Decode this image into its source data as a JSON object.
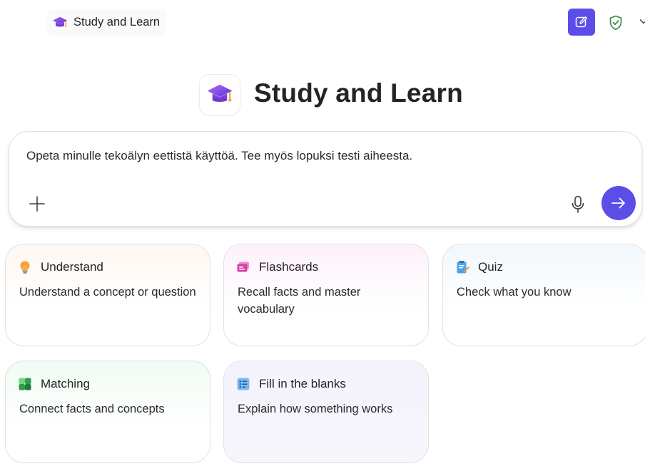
{
  "header": {
    "app_title": "Study and Learn",
    "new_chat_icon": "edit-square-icon",
    "shield_icon": "shield-check-icon"
  },
  "hero": {
    "title": "Study and Learn",
    "icon": "graduation-cap-icon"
  },
  "composer": {
    "text": "Opeta minulle tekoälyn eettistä käyttöä. Tee myös lopuksi testi aiheesta.",
    "add_icon": "plus-icon",
    "mic_icon": "microphone-icon",
    "send_icon": "arrow-right-icon"
  },
  "cards": [
    {
      "id": "understand",
      "icon": "lightbulb-icon",
      "title": "Understand",
      "description": "Understand a concept or question"
    },
    {
      "id": "flashcards",
      "icon": "flashcards-icon",
      "title": "Flashcards",
      "description": "Recall facts and master vocabulary"
    },
    {
      "id": "quiz",
      "icon": "quiz-icon",
      "title": "Quiz",
      "description": "Check what you know"
    },
    {
      "id": "matching",
      "icon": "matching-icon",
      "title": "Matching",
      "description": "Connect facts and concepts"
    },
    {
      "id": "fill",
      "icon": "fill-blanks-icon",
      "title": "Fill in the blanks",
      "description": "Explain how something works"
    }
  ],
  "colors": {
    "accent": "#5b4ee8",
    "shield": "#2e8b3d"
  }
}
